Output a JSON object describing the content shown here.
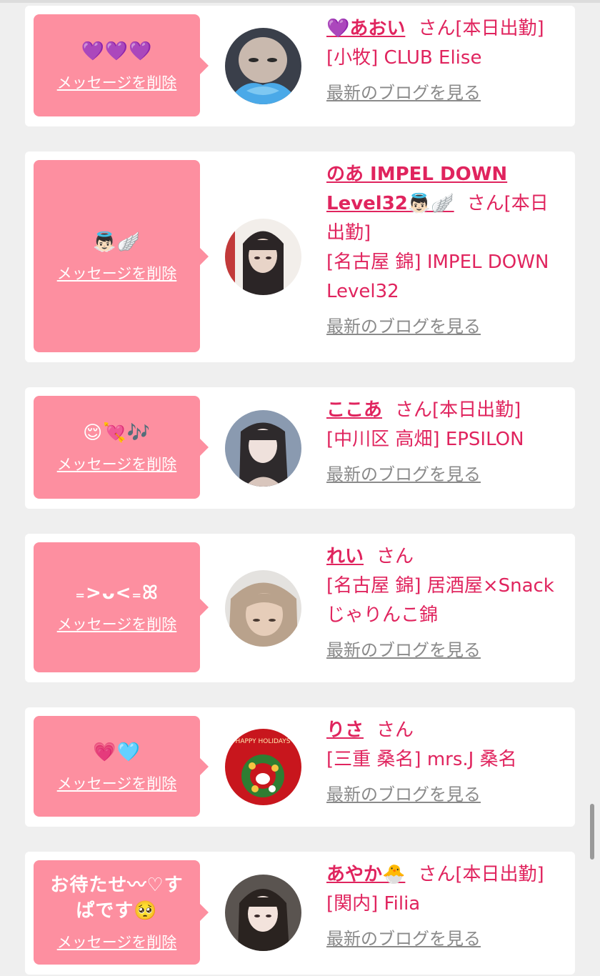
{
  "cards": [
    {
      "message": "💜💜💜",
      "delete_label": "メッセージを削除",
      "name": "💜あおい",
      "honorific": "さん",
      "status": "[本日出勤]",
      "shop": "[小牧] CLUB Elise",
      "blog_label": "最新のブログを見る"
    },
    {
      "message": "👼🏻🪽",
      "delete_label": "メッセージを削除",
      "name": "のあ IMPEL DOWN Level32👼🏻🪽",
      "honorific": "さん",
      "status": "[本日出勤]",
      "shop": "[名古屋 錦] IMPEL DOWN Level32",
      "blog_label": "最新のブログを見る"
    },
    {
      "message": "😌💘🎶",
      "delete_label": "メッセージを削除",
      "name": "ここあ",
      "honorific": "さん",
      "status": "[本日出勤]",
      "shop": "[中川区 高畑] EPSILON",
      "blog_label": "最新のブログを見る"
    },
    {
      "message": "₌>ᴗ<₌ꕤ",
      "delete_label": "メッセージを削除",
      "name": "れい",
      "honorific": "さん",
      "status": "",
      "shop": "[名古屋 錦] 居酒屋×Snack じゃりんこ錦",
      "blog_label": "最新のブログを見る"
    },
    {
      "message": "💗🩵",
      "delete_label": "メッセージを削除",
      "name": "りさ",
      "honorific": "さん",
      "status": "",
      "shop": "[三重 桑名] mrs.J 桑名",
      "blog_label": "最新のブログを見る"
    },
    {
      "message": "お待たせ〰♡すぱです🥺",
      "delete_label": "メッセージを削除",
      "name": "あやか🐣",
      "honorific": "さん",
      "status": "[本日出勤]",
      "shop": "[関内] Filia",
      "blog_label": "最新のブログを見る"
    }
  ],
  "avatar_caption": "HAPPY HOLIDAYS",
  "colors": {
    "accent": "#e0245e",
    "bubble": "#fd8fa0",
    "background": "#efefef",
    "link_gray": "#8a8a8a"
  }
}
